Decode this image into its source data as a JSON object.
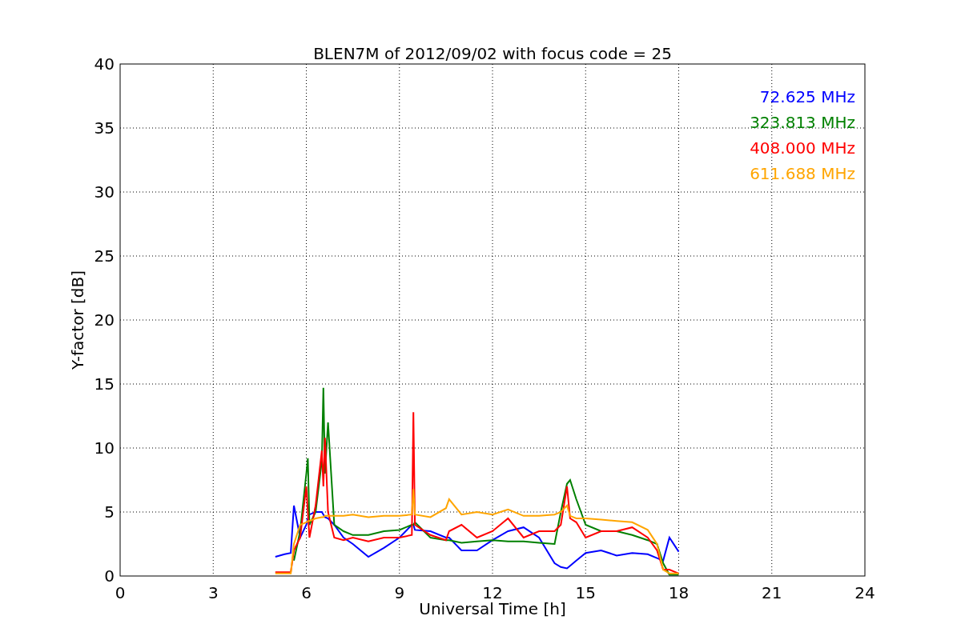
{
  "chart_data": {
    "type": "line",
    "title": "BLEN7M of 2012/09/02 with focus code = 25",
    "xlabel": "Universal Time [h]",
    "ylabel": "Y-factor [dB]",
    "x": [
      5,
      5.3,
      5.5,
      5.6,
      5.8,
      6,
      6.05,
      6.1,
      6.3,
      6.5,
      6.55,
      6.6,
      6.7,
      6.9,
      7.2,
      7.5,
      8,
      8.5,
      9,
      9.4,
      9.45,
      9.5,
      10,
      10.5,
      10.6,
      11,
      11.5,
      12,
      12.5,
      13,
      13.5,
      14,
      14.2,
      14.4,
      14.5,
      14.7,
      15,
      15.5,
      16,
      16.5,
      17,
      17.3,
      17.5,
      17.7,
      18
    ],
    "series": [
      {
        "name": "72.625 MHz",
        "color": "#0000ff",
        "values": [
          1.5,
          1.7,
          1.8,
          5.5,
          3,
          4,
          4.5,
          4.8,
          5,
          5,
          4.8,
          4.6,
          4.5,
          4,
          3,
          2.5,
          1.5,
          2.2,
          3,
          4,
          4,
          3.6,
          3.5,
          3,
          3,
          2,
          2,
          2.8,
          3.5,
          3.8,
          3,
          1,
          0.7,
          0.6,
          0.8,
          1.2,
          1.8,
          2,
          1.6,
          1.8,
          1.7,
          1.4,
          1.2,
          3,
          1.9
        ]
      },
      {
        "name": "323.813 MHz",
        "color": "#008000",
        "values": [
          null,
          null,
          null,
          1.2,
          3.5,
          8,
          9.2,
          4,
          5,
          9,
          14.7,
          8,
          12,
          4,
          3.5,
          3.2,
          3.2,
          3.5,
          3.6,
          4,
          4,
          4.2,
          3,
          2.8,
          2.8,
          2.6,
          2.7,
          2.8,
          2.7,
          2.7,
          2.6,
          2.5,
          5,
          7.2,
          7.5,
          6,
          4,
          3.5,
          3.5,
          3.2,
          2.8,
          2.5,
          1,
          0.1,
          0.1
        ]
      },
      {
        "name": "408.000 MHz",
        "color": "#ff0000",
        "values": [
          0.3,
          0.3,
          0.3,
          2,
          3,
          7,
          5,
          3,
          5.5,
          9.8,
          7,
          10.8,
          5,
          3,
          2.8,
          3,
          2.7,
          3,
          3,
          3.2,
          12.8,
          4,
          3.2,
          2.8,
          3.5,
          4,
          3,
          3.5,
          4.5,
          3,
          3.5,
          3.5,
          4,
          7,
          4.5,
          4.2,
          3,
          3.5,
          3.5,
          3.8,
          3,
          2,
          0.5,
          0.5,
          0.2
        ]
      },
      {
        "name": "611.688 MHz",
        "color": "#ffa500",
        "values": [
          0.2,
          0.2,
          0.2,
          2.5,
          4,
          4.2,
          4.3,
          4.3,
          4.5,
          4.6,
          4.6,
          4.7,
          4.7,
          4.7,
          4.7,
          4.8,
          4.6,
          4.7,
          4.7,
          4.8,
          6.8,
          4.8,
          4.6,
          5.3,
          6,
          4.8,
          5,
          4.8,
          5.2,
          4.7,
          4.7,
          4.8,
          5,
          5.5,
          4.7,
          4.5,
          4.5,
          4.4,
          4.3,
          4.2,
          3.6,
          2.5,
          0.5,
          0.2,
          0.2
        ]
      }
    ],
    "grid": true,
    "xlim": [
      0,
      24
    ],
    "ylim": [
      0,
      40
    ],
    "xticks": [
      0,
      3,
      6,
      9,
      12,
      15,
      18,
      21,
      24
    ],
    "yticks": [
      0,
      5,
      10,
      15,
      20,
      25,
      30,
      35,
      40
    ]
  }
}
